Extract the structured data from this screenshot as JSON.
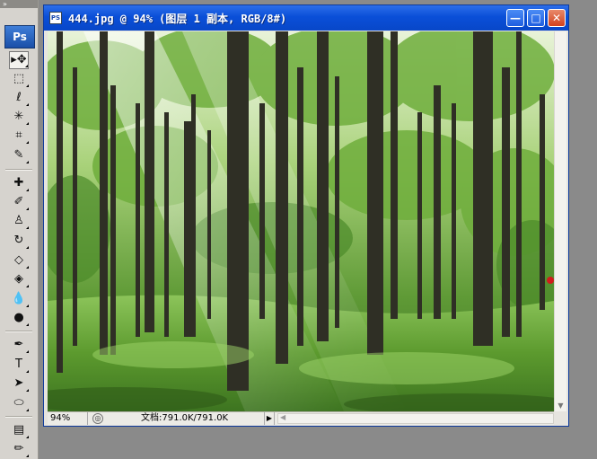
{
  "toolbox": {
    "header_glyph": "»",
    "logo": "Ps",
    "tools": [
      {
        "name": "move-tool-icon",
        "glyph": "▸✥",
        "active": true
      },
      {
        "name": "marquee-tool-icon",
        "glyph": "⬚",
        "active": false
      },
      {
        "name": "lasso-tool-icon",
        "glyph": "ℓ",
        "active": false
      },
      {
        "name": "magic-wand-tool-icon",
        "glyph": "✳",
        "active": false
      },
      {
        "name": "crop-tool-icon",
        "glyph": "⌗",
        "active": false
      },
      {
        "name": "slice-tool-icon",
        "glyph": "✎",
        "active": false
      },
      {
        "name": "healing-brush-tool-icon",
        "glyph": "✚",
        "active": false
      },
      {
        "name": "brush-tool-icon",
        "glyph": "✐",
        "active": false
      },
      {
        "name": "clone-stamp-tool-icon",
        "glyph": "♙",
        "active": false
      },
      {
        "name": "history-brush-tool-icon",
        "glyph": "↻",
        "active": false
      },
      {
        "name": "eraser-tool-icon",
        "glyph": "◇",
        "active": false
      },
      {
        "name": "paint-bucket-tool-icon",
        "glyph": "◈",
        "active": false
      },
      {
        "name": "blur-tool-icon",
        "glyph": "💧",
        "active": false
      },
      {
        "name": "dodge-tool-icon",
        "glyph": "●",
        "active": false
      },
      {
        "name": "pen-tool-icon",
        "glyph": "✒",
        "active": false
      },
      {
        "name": "type-tool-icon",
        "glyph": "T",
        "active": false
      },
      {
        "name": "path-selection-tool-icon",
        "glyph": "➤",
        "active": false
      },
      {
        "name": "shape-tool-icon",
        "glyph": "⬭",
        "active": false
      },
      {
        "name": "notes-tool-icon",
        "glyph": "▤",
        "active": false
      },
      {
        "name": "eyedropper-tool-icon",
        "glyph": "✏",
        "active": false
      }
    ]
  },
  "document": {
    "icon_label": "PS",
    "title": "444.jpg @ 94% (图层 1 副本, RGB/8#)",
    "buttons": {
      "minimize": "—",
      "maximize": "□",
      "close": "✕"
    }
  },
  "status": {
    "zoom": "94%",
    "doc_info": "文档:791.0K/791.0K",
    "arrow": "▶",
    "scroll_left": "◀",
    "scroll_down": "▼"
  },
  "colors": {
    "titlebar": "#0a4fd8",
    "close_button": "#d2411d",
    "forest_light": "#cfe6b0",
    "grass": "#6aa838",
    "trunk": "#2f2f25"
  }
}
